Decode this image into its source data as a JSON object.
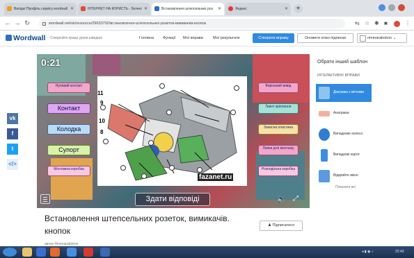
{
  "browser": {
    "tabs": [
      {
        "label": "Вихідні Профіль сервісу wordwall"
      },
      {
        "label": "ІНТЕРНЕТ НА КОРИСТЬ - Зелені"
      },
      {
        "label": "Встановлення штепсельних роз"
      },
      {
        "label": "Яндекс"
      }
    ],
    "new_tab": "+",
    "url": "wordwall.net/uk/resource/29633702/встановлення-штепсельних-розеток-вимикачів-кнопок"
  },
  "header": {
    "logo": "Wordwall",
    "tagline": "Створюйте кращі уроки швидше",
    "nav": [
      "Головна",
      "Функції",
      "Мої вправи",
      "Мої результати"
    ],
    "create_button": "Створити вправу",
    "plan_button": "Оновити план підписки",
    "user": "rimmarabokon"
  },
  "share": [
    "vk",
    "f",
    "t",
    "</>"
  ],
  "activity": {
    "timer": "0:21",
    "labels_left": [
      "Нулевий контакт",
      "Контакт",
      "Колодка",
      "Супорт",
      "Монтажна коробка"
    ],
    "labels_right": [
      "Вирізаний вивід",
      "Ґвинт кріплення",
      "Захисна пластина",
      "Лапки для монтажу",
      "Розподільча коробка"
    ],
    "diagram_numbers": [
      "11",
      "9",
      "10",
      "8"
    ],
    "watermark": "fazanet.ru",
    "submit_label": "Здати відповіді"
  },
  "right_panel": {
    "title": "Обрати інший шаблон",
    "subtitle": "ІНТЕРАКТИВНІ ВПРАВИ",
    "templates": [
      {
        "label": "Діаграма з мітками",
        "selected": true
      },
      {
        "label": "Анаграма",
        "selected": false
      },
      {
        "label": "Випадкове колесо",
        "selected": false
      },
      {
        "label": "Випадкові карти",
        "selected": false
      },
      {
        "label": "Відкрийте вікно",
        "selected": false
      }
    ],
    "show_all": "Показати всі"
  },
  "page": {
    "title": "Встановлення штепсельних розеток, вимикачів. кнопок",
    "subscribe": "Підписатися",
    "author": "автор Rimmarabokon"
  },
  "taskbar": {
    "time": "22:43"
  },
  "colors": {
    "accent": "#2f8ae0",
    "label_pink": "#f2a6c9",
    "label_blue": "#b9dcf3"
  }
}
